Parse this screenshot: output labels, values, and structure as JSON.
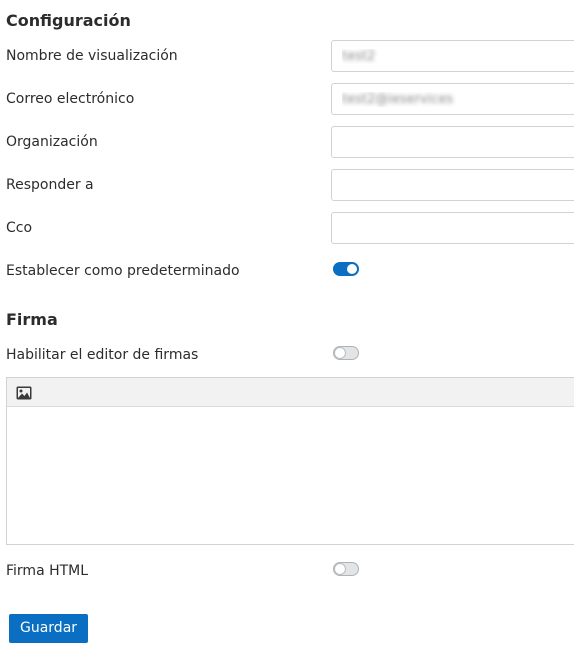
{
  "config": {
    "title": "Configuración",
    "fields": [
      {
        "label": "Nombre de visualización",
        "value": "test2",
        "placeholder": ""
      },
      {
        "label": "Correo electrónico",
        "value": "test2@ieservices",
        "placeholder": ""
      },
      {
        "label": "Organización",
        "value": "",
        "placeholder": ""
      },
      {
        "label": "Responder a",
        "value": "",
        "placeholder": ""
      },
      {
        "label": "Cco",
        "value": "",
        "placeholder": ""
      }
    ],
    "default_label": "Establecer como predeterminado",
    "default_on": true
  },
  "signature": {
    "title": "Firma",
    "editor_label": "Habilitar el editor de firmas",
    "editor_on": false,
    "toolbar_icon": "image-icon",
    "html_label": "Firma HTML",
    "html_on": false
  },
  "actions": {
    "save_label": "Guardar"
  },
  "colors": {
    "accent": "#0a6ec2"
  }
}
